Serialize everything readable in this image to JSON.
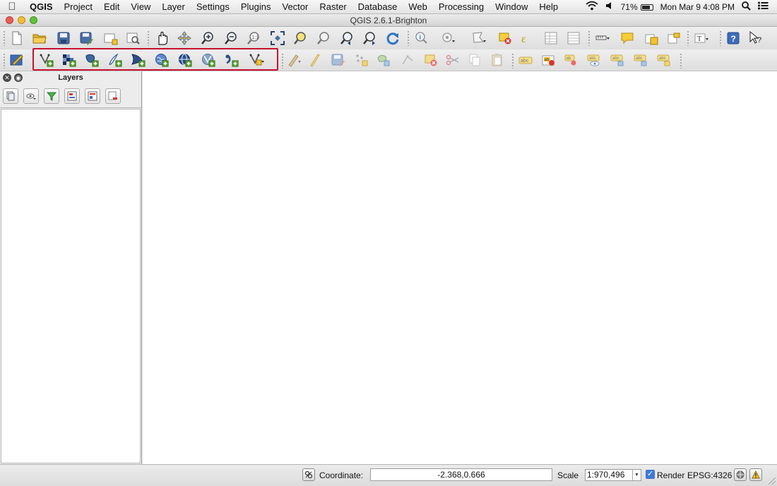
{
  "menubar": {
    "app_name": "QGIS",
    "items": [
      "Project",
      "Edit",
      "View",
      "Layer",
      "Settings",
      "Plugins",
      "Vector",
      "Raster",
      "Database",
      "Web",
      "Processing",
      "Window",
      "Help"
    ],
    "battery": "71%",
    "clock": "Mon Mar 9  4:08 PM"
  },
  "window": {
    "title": "QGIS 2.6.1-Brighton"
  },
  "toolbar_file_nav": {
    "icons": [
      "new-project-icon",
      "open-project-icon",
      "save-project-icon",
      "save-as-icon",
      "new-print-composer-icon",
      "composer-manager-icon",
      "pan-map-icon",
      "pan-to-selection-icon",
      "zoom-in-icon",
      "zoom-out-icon",
      "zoom-actual-size-icon",
      "zoom-full-icon",
      "zoom-to-selection-icon",
      "zoom-to-layer-icon",
      "zoom-last-icon",
      "zoom-next-icon",
      "refresh-icon",
      "identify-icon",
      "select-features-icon",
      "select-by-polygon-icon",
      "deselect-icon",
      "expression-icon",
      "attribute-table-icon",
      "statistics-icon",
      "measure-icon",
      "map-tips-icon",
      "new-bookmark-icon",
      "show-bookmarks-icon",
      "text-annotation-icon",
      "help-contents-icon",
      "whats-this-icon"
    ]
  },
  "toolbar_layers": {
    "highlight_color": "#c8102e",
    "add_layer_icons": [
      "add-vector-layer-icon",
      "add-raster-layer-icon",
      "add-postgis-layer-icon",
      "add-spatialite-layer-icon",
      "add-mssql-layer-icon",
      "add-wms-layer-icon",
      "add-wcs-layer-icon",
      "add-wfs-layer-icon",
      "add-delimited-text-layer-icon",
      "new-shapefile-layer-icon"
    ],
    "edit_icons": [
      "current-edits-icon",
      "toggle-editing-icon",
      "save-layer-edits-icon",
      "add-feature-icon",
      "move-feature-icon",
      "node-tool-icon",
      "delete-selected-icon",
      "cut-features-icon",
      "copy-features-icon",
      "paste-features-icon"
    ],
    "label_icons": [
      "layer-labeling-icon",
      "diagram-options-icon",
      "pin-labels-icon",
      "show-hide-labels-icon",
      "move-label-icon",
      "rotate-label-icon",
      "change-label-icon"
    ]
  },
  "layers_panel": {
    "title": "Layers",
    "tools": [
      "add-group-icon",
      "manage-visibility-icon",
      "filter-legend-icon",
      "expand-all-icon",
      "collapse-all-icon",
      "remove-layer-icon"
    ]
  },
  "statusbar": {
    "coordinate_label": "Coordinate:",
    "coordinate_value": "-2.368,0.666",
    "scale_label": "Scale",
    "scale_value": "1:970,496",
    "render_label": "Render",
    "render_checked": true,
    "crs": "EPSG:4326"
  }
}
